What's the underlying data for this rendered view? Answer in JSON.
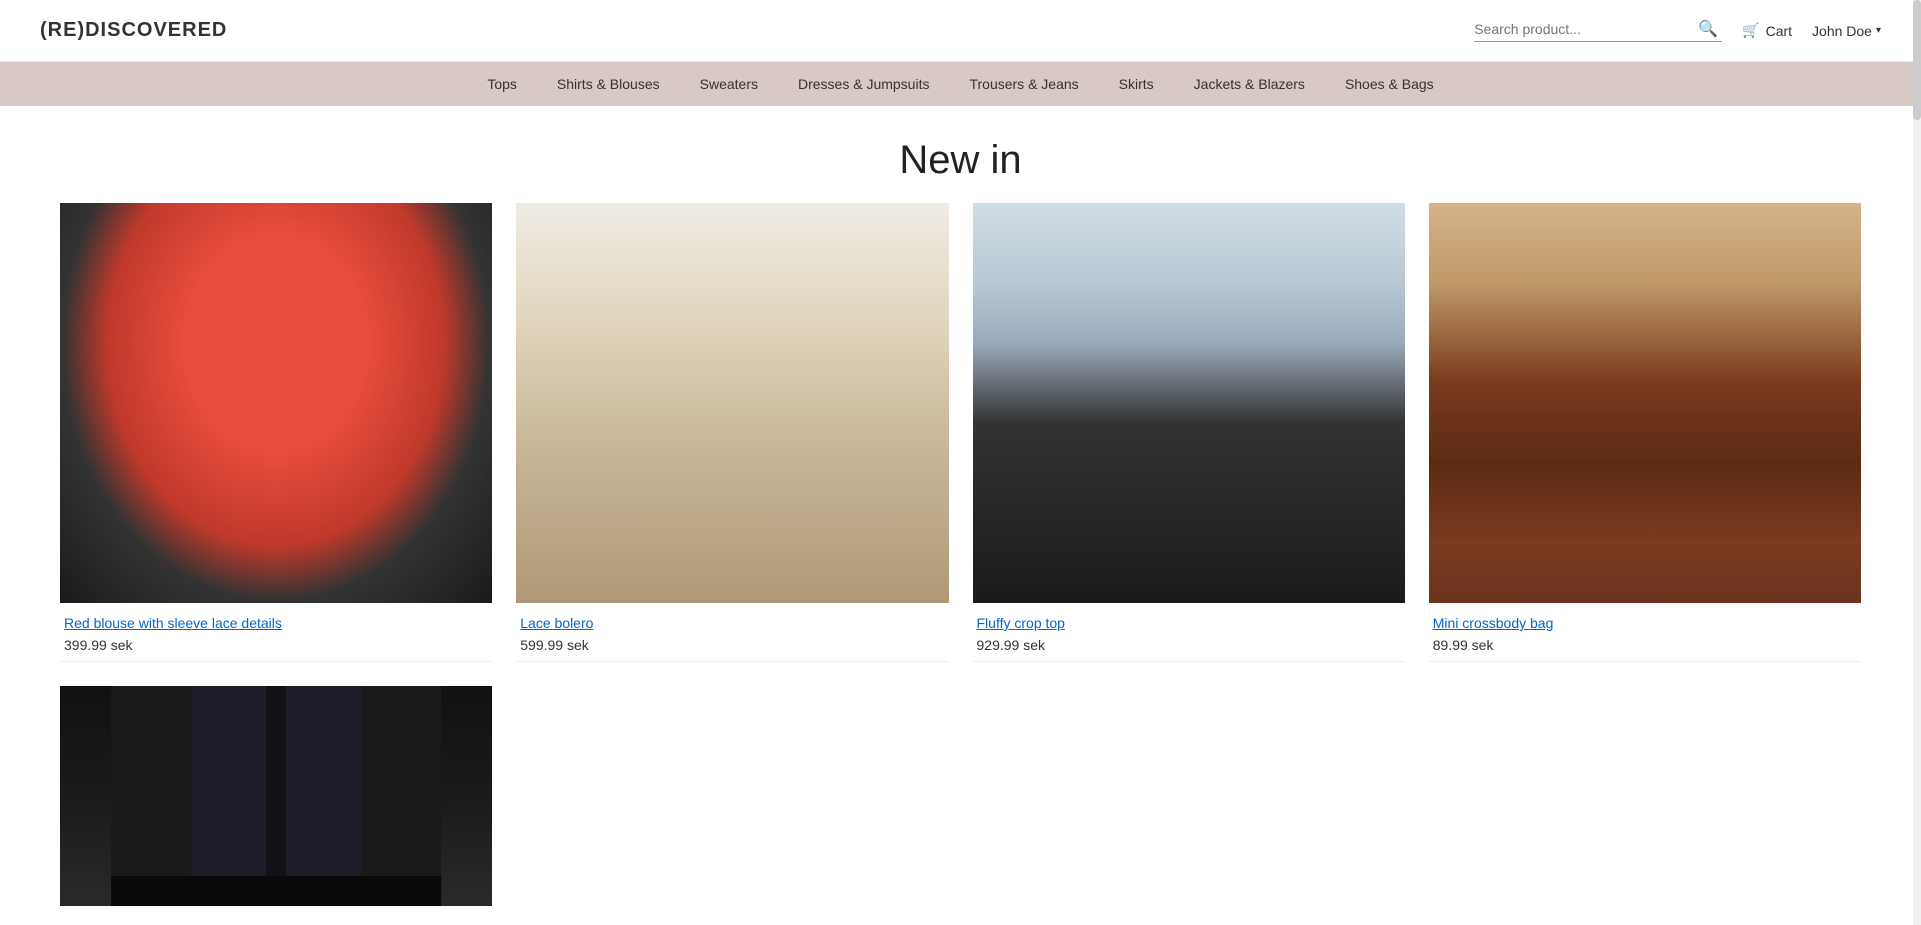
{
  "site": {
    "logo": "(RE)DISCOVERED",
    "title": "(Re)Discovered"
  },
  "header": {
    "search_placeholder": "Search product...",
    "cart_label": "Cart",
    "user_label": "John Doe",
    "search_icon": "🔍",
    "cart_icon": "🛒"
  },
  "nav": {
    "items": [
      {
        "label": "Tops",
        "href": "#"
      },
      {
        "label": "Shirts & Blouses",
        "href": "#"
      },
      {
        "label": "Sweaters",
        "href": "#"
      },
      {
        "label": "Dresses & Jumpsuits",
        "href": "#"
      },
      {
        "label": "Trousers & Jeans",
        "href": "#"
      },
      {
        "label": "Skirts",
        "href": "#"
      },
      {
        "label": "Jackets & Blazers",
        "href": "#"
      },
      {
        "label": "Shoes & Bags",
        "href": "#"
      }
    ]
  },
  "main": {
    "section_title": "New in",
    "products": [
      {
        "id": 1,
        "name": "Red blouse with sleeve lace details",
        "price": "399.99",
        "currency": "sek",
        "img_class": "product-img-1"
      },
      {
        "id": 2,
        "name": "Lace bolero",
        "price": "599.99",
        "currency": "sek",
        "img_class": "product-img-2"
      },
      {
        "id": 3,
        "name": "Fluffy crop top",
        "price": "929.99",
        "currency": "sek",
        "img_class": "product-img-3"
      },
      {
        "id": 4,
        "name": "Mini crossbody bag",
        "price": "89.99",
        "currency": "sek",
        "img_class": "product-img-4"
      }
    ],
    "partial_products": [
      {
        "id": 5,
        "img_class": "product-img-5"
      }
    ]
  }
}
